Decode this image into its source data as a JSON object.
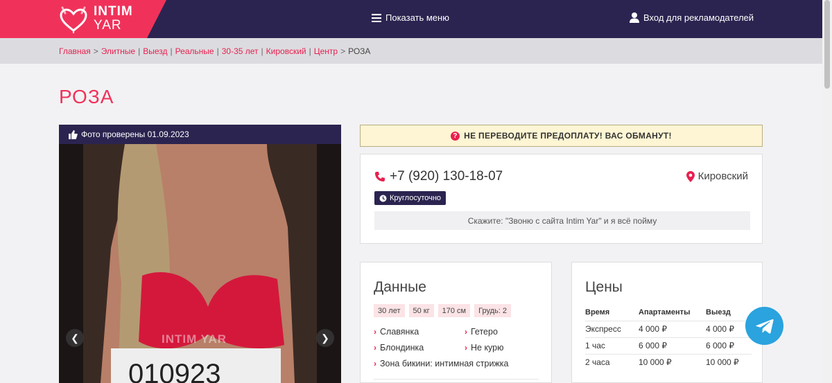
{
  "header": {
    "logo_line1": "INTIM",
    "logo_line2": "YAR",
    "menu_label": "Показать меню",
    "advertisers_label": "Вход для рекламодателей"
  },
  "breadcrumbs": {
    "items": [
      "Главная",
      "Элитные",
      "Выезд",
      "Реальные",
      "30-35 лет",
      "Кировский",
      "Центр"
    ],
    "current": "РОЗА"
  },
  "profile": {
    "name": "РОЗА",
    "photo_verified": "Фото проверены 01.09.2023",
    "watermark": "INTIM YAR",
    "sign_text": "010923"
  },
  "warning": "НЕ ПЕРЕВОДИТЕ ПРЕДОПЛАТУ! ВАС ОБМАНУТ!",
  "contact": {
    "phone": "+7 (920) 130-18-07",
    "district": "Кировский",
    "hours": "Круглосуточно",
    "say_text": "Скажите: \"Звоню с сайта Intim Yar\" и я всё пойму"
  },
  "data_card": {
    "title": "Данные",
    "chips": [
      "30 лет",
      "50 кг",
      "170 см",
      "Грудь: 2"
    ],
    "traits": [
      "Славянка",
      "Гетеро",
      "Блондинка",
      "Не курю",
      "Зона бикини: интимная стрижка"
    ]
  },
  "prices": {
    "title": "Цены",
    "headers": [
      "Время",
      "Апартаменты",
      "Выезд"
    ],
    "rows": [
      [
        "Экспресс",
        "4 000 ₽",
        "4 000 ₽"
      ],
      [
        "1 час",
        "6 000 ₽",
        "6 000 ₽"
      ],
      [
        "2 часа",
        "10 000 ₽",
        "10 000 ₽"
      ]
    ]
  },
  "colors": {
    "brand_pink": "#f0325a",
    "navy": "#2b2450",
    "telegram": "#2aa3de"
  }
}
